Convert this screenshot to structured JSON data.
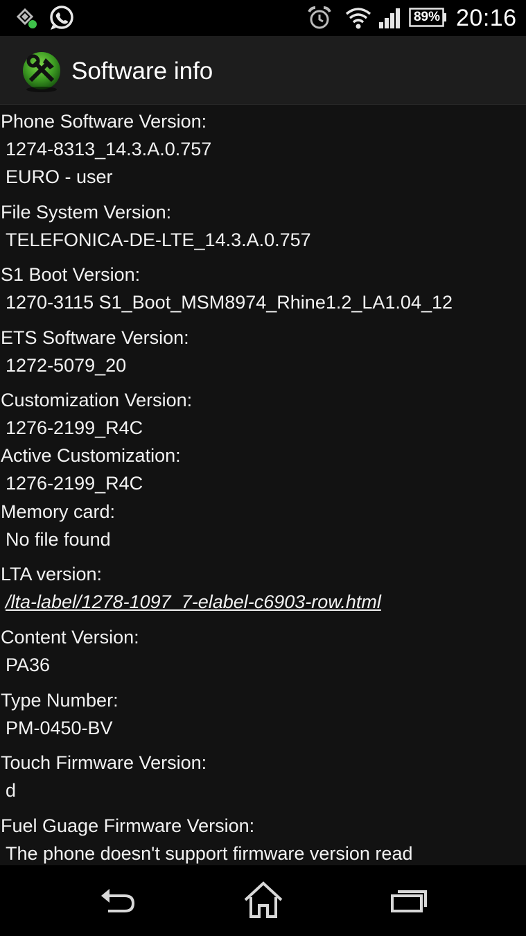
{
  "status_bar": {
    "time": "20:16",
    "battery": "89%",
    "icons": [
      "notification-sync-icon",
      "whatsapp-icon",
      "alarm-icon",
      "wifi-icon",
      "signal-icon",
      "battery-icon"
    ]
  },
  "action_bar": {
    "title": "Software info",
    "app_icon": "tools-hammer-wrench-icon"
  },
  "entries": [
    {
      "label": "Phone Software Version:",
      "values": [
        "1274-8313_14.3.A.0.757",
        "EURO - user"
      ]
    },
    {
      "label": "File System Version:",
      "values": [
        "TELEFONICA-DE-LTE_14.3.A.0.757"
      ]
    },
    {
      "label": "S1 Boot Version:",
      "values": [
        "1270-3115 S1_Boot_MSM8974_Rhine1.2_LA1.04_12"
      ]
    },
    {
      "label": "ETS Software Version:",
      "values": [
        "1272-5079_20"
      ]
    },
    {
      "label": "Customization Version:",
      "values": [
        "1276-2199_R4C"
      ]
    },
    {
      "label": "Active Customization:",
      "values": [
        "1276-2199_R4C"
      ]
    },
    {
      "label": "Memory card:",
      "values": [
        "No file found"
      ]
    },
    {
      "label": "LTA version:",
      "values": [
        "/lta-label/1278-1097_7-elabel-c6903-row.html"
      ]
    },
    {
      "label": "Content Version:",
      "values": [
        "PA36"
      ]
    },
    {
      "label": "Type Number:",
      "values": [
        "PM-0450-BV"
      ]
    },
    {
      "label": "Touch Firmware Version:",
      "values": [
        "d"
      ]
    },
    {
      "label": "Fuel Guage Firmware Version:",
      "values": [
        "The phone doesn't support firmware version read"
      ]
    }
  ],
  "nav_bar": {
    "icons": [
      "back-icon",
      "home-icon",
      "recent-apps-icon"
    ]
  }
}
